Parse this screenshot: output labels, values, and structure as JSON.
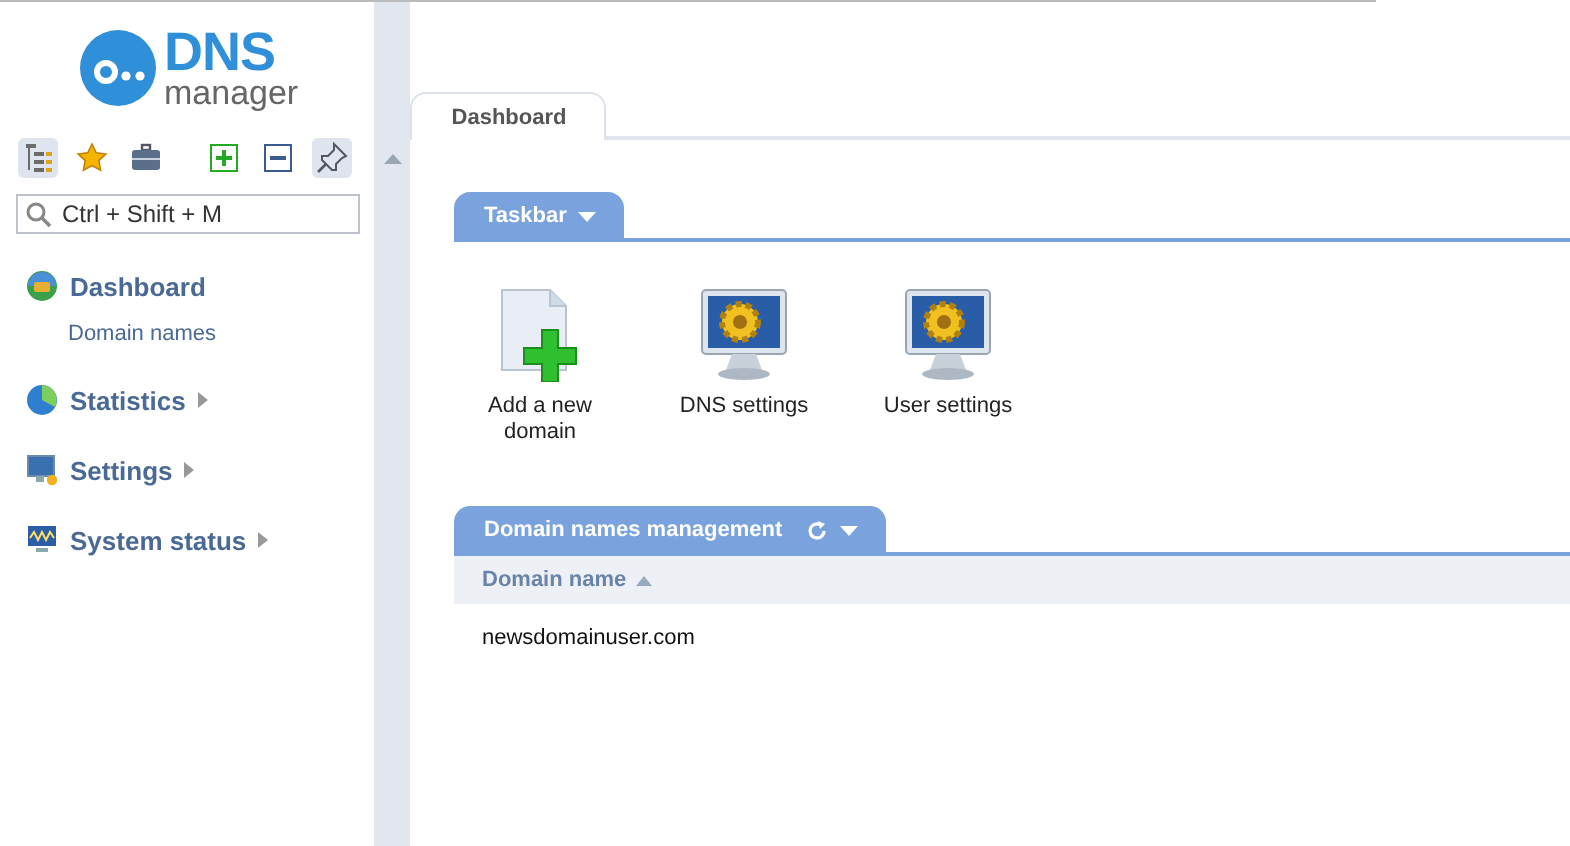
{
  "logo": {
    "word": "DNS",
    "subtitle": "manager"
  },
  "sidebar": {
    "toolbar": [
      {
        "kind": "tree",
        "pressed": true
      },
      {
        "kind": "star",
        "pressed": false
      },
      {
        "kind": "case",
        "pressed": false
      },
      {
        "kind": "expand",
        "pressed": false
      },
      {
        "kind": "collapse",
        "pressed": false
      },
      {
        "kind": "pin",
        "pressed": true
      }
    ],
    "search": {
      "placeholder": "Ctrl + Shift + M"
    },
    "menu": [
      {
        "kind": "dashboard",
        "label": "Dashboard",
        "has_submenu": false,
        "children": [
          {
            "label": "Domain names"
          }
        ]
      },
      {
        "kind": "statistics",
        "label": "Statistics",
        "has_submenu": true
      },
      {
        "kind": "settings",
        "label": "Settings",
        "has_submenu": true
      },
      {
        "kind": "status",
        "label": "System status",
        "has_submenu": true
      }
    ]
  },
  "tabs": [
    {
      "label": "Dashboard",
      "selected": true
    }
  ],
  "taskbar": {
    "title": "Taskbar",
    "items": [
      {
        "kind": "add",
        "label": "Add a new domain"
      },
      {
        "kind": "monitor",
        "label": "DNS settings"
      },
      {
        "kind": "monitor",
        "label": "User settings"
      }
    ]
  },
  "domains": {
    "title": "Domain names management",
    "columns": [
      {
        "label": "Domain name",
        "sort_ascending": true
      }
    ],
    "rows": [
      [
        "newsdomainuser.com"
      ]
    ]
  }
}
